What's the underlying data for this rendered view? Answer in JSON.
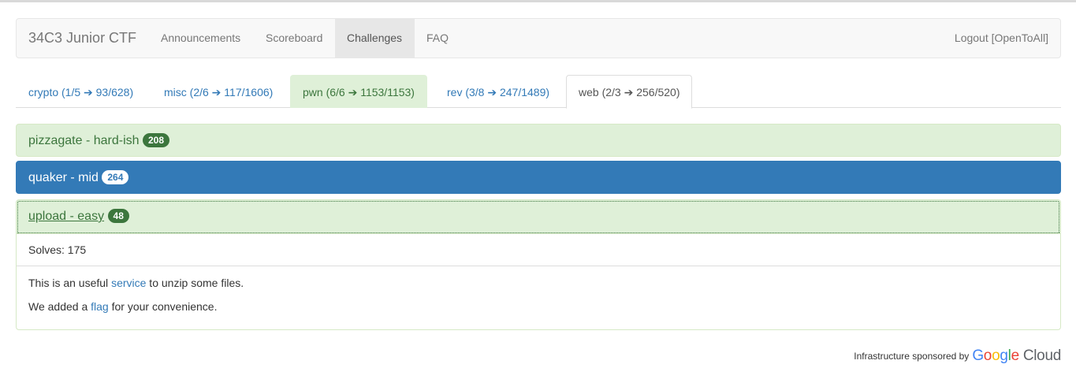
{
  "navbar": {
    "brand": "34C3 Junior CTF",
    "items": [
      {
        "label": "Announcements"
      },
      {
        "label": "Scoreboard"
      },
      {
        "label": "Challenges"
      },
      {
        "label": "FAQ"
      }
    ],
    "logout": "Logout [OpenToAll]"
  },
  "tabs": [
    {
      "label": "crypto (1/5 ➔ 93/628)",
      "state": "normal"
    },
    {
      "label": "misc (2/6 ➔ 117/1606)",
      "state": "normal"
    },
    {
      "label": "pwn (6/6 ➔ 1153/1153)",
      "state": "solved"
    },
    {
      "label": "rev (3/8 ➔ 247/1489)",
      "state": "normal"
    },
    {
      "label": "web (2/3 ➔ 256/520)",
      "state": "active"
    }
  ],
  "challenges": [
    {
      "title": "pizzagate - hard-ish",
      "points": "208",
      "status": "solved"
    },
    {
      "title": "quaker - mid",
      "points": "264",
      "status": "unsolved"
    },
    {
      "title": "upload - easy",
      "points": "48",
      "status": "solved-open"
    }
  ],
  "open_challenge": {
    "solves": "Solves: 175",
    "desc_line1_pre": "This is an useful ",
    "desc_line1_link": "service",
    "desc_line1_post": " to unzip some files.",
    "desc_line2_pre": "We added a ",
    "desc_line2_link": "flag",
    "desc_line2_post": " for your convenience."
  },
  "footer": {
    "text": "Infrastructure sponsored by",
    "logo_google": "Google",
    "logo_cloud": "Cloud",
    "google_colors": [
      "#4285f4",
      "#ea4335",
      "#fbbc05",
      "#4285f4",
      "#34a853",
      "#ea4335"
    ]
  },
  "colors": {
    "success_bg": "#dff0d8",
    "success_text": "#3c763d",
    "primary": "#337ab7"
  }
}
